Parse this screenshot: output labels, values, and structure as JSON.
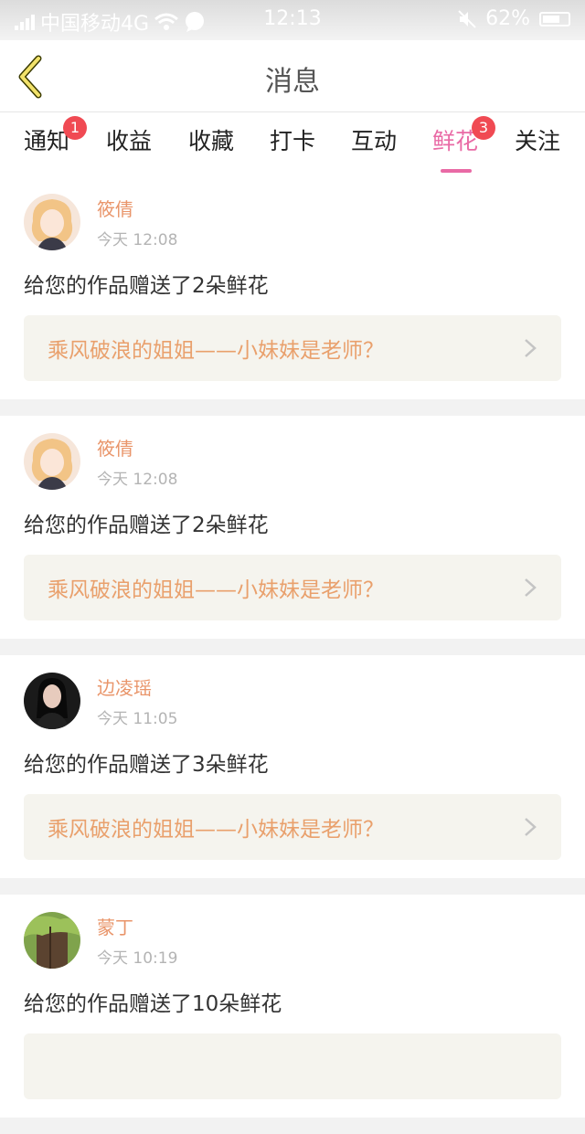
{
  "status_bar": {
    "carrier": "中国移动4G",
    "time": "12:13",
    "battery": "62%"
  },
  "nav": {
    "title": "消息"
  },
  "tabs": [
    {
      "label": "通知",
      "badge": "1"
    },
    {
      "label": "收益",
      "badge": ""
    },
    {
      "label": "收藏",
      "badge": ""
    },
    {
      "label": "打卡",
      "badge": ""
    },
    {
      "label": "互动",
      "badge": ""
    },
    {
      "label": "鲜花",
      "badge": "3",
      "active": true
    },
    {
      "label": "关注",
      "badge": ""
    }
  ],
  "messages": [
    {
      "user": "筱倩",
      "time": "今天 12:08",
      "text": "给您的作品赠送了2朵鲜花",
      "work": "乘风破浪的姐姐——小妹妹是老师？"
    },
    {
      "user": "筱倩",
      "time": "今天 12:08",
      "text": "给您的作品赠送了2朵鲜花",
      "work": "乘风破浪的姐姐——小妹妹是老师？"
    },
    {
      "user": "边凌瑶",
      "time": "今天 11:05",
      "text": "给您的作品赠送了3朵鲜花",
      "work": "乘风破浪的姐姐——小妹妹是老师？"
    },
    {
      "user": "蒙丁",
      "time": "今天 10:19",
      "text": "给您的作品赠送了10朵鲜花",
      "work": ""
    }
  ],
  "colors": {
    "accent": "#e96aa5",
    "badge": "#f04a53",
    "username": "#e9956a",
    "work_title": "#e9a06c"
  }
}
